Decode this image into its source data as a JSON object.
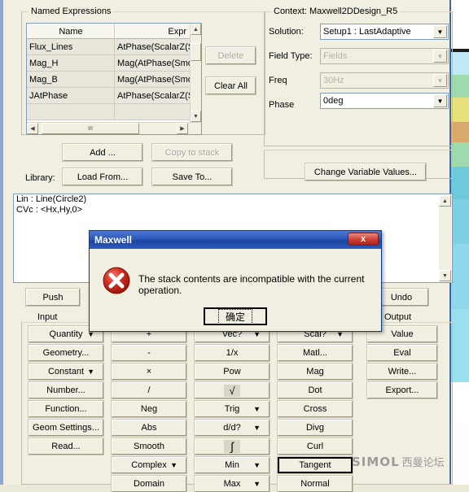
{
  "window": {
    "named_expressions": {
      "legend": "Named Expressions",
      "columns": [
        "Name",
        "Expr"
      ],
      "rows": [
        {
          "name": "Flux_Lines",
          "expr": "AtPhase(ScalarZ(Smo"
        },
        {
          "name": "Mag_H",
          "expr": "Mag(AtPhase(Smooth"
        },
        {
          "name": "Mag_B",
          "expr": "Mag(AtPhase(Smooth"
        },
        {
          "name": "JAtPhase",
          "expr": "AtPhase(ScalarZ(Smo"
        },
        {
          "name": "",
          "expr": ""
        }
      ],
      "delete_label": "Delete",
      "clear_all_label": "Clear All"
    },
    "context": {
      "legend": "Context: Maxwell2DDesign_R5",
      "fields": [
        {
          "label": "Solution:",
          "value": "Setup1 : LastAdaptive",
          "disabled": false
        },
        {
          "label": "Field Type:",
          "value": "Fields",
          "disabled": true
        },
        {
          "label": "Freq",
          "value": "30Hz",
          "disabled": true
        },
        {
          "label": "Phase",
          "value": "0deg",
          "disabled": false
        }
      ],
      "change_variable_values_label": "Change Variable Values..."
    },
    "actions": {
      "add_label": "Add ...",
      "copy_to_stack_label": "Copy to stack",
      "library_label": "Library:",
      "load_from_label": "Load From...",
      "save_to_label": "Save To..."
    },
    "stack": {
      "lines": [
        "Lin : Line(Circle2)",
        "CVc : <Hx,Hy,0>"
      ]
    },
    "stack_controls": {
      "push_label": "Push",
      "undo_label": "Undo",
      "input_label": "Input",
      "output_label": "Output"
    },
    "calculator": {
      "columns": [
        {
          "name": "input",
          "buttons": [
            {
              "label": "Quantity",
              "caret": true
            },
            {
              "label": "Geometry...",
              "caret": false
            },
            {
              "label": "Constant",
              "caret": true
            },
            {
              "label": "Number...",
              "caret": false
            },
            {
              "label": "Function...",
              "caret": false
            },
            {
              "label": "Geom Settings...",
              "caret": false
            },
            {
              "label": "Read...",
              "caret": false
            }
          ]
        },
        {
          "name": "general",
          "buttons": [
            {
              "label": "+",
              "caret": false
            },
            {
              "label": "-",
              "caret": false
            },
            {
              "label": "×",
              "caret": false
            },
            {
              "label": "/",
              "caret": false
            },
            {
              "label": "Neg",
              "caret": false
            },
            {
              "label": "Abs",
              "caret": false
            },
            {
              "label": "Smooth",
              "caret": false
            },
            {
              "label": "Complex",
              "caret": true
            },
            {
              "label": "Domain",
              "caret": false
            }
          ]
        },
        {
          "name": "scalar",
          "buttons": [
            {
              "label": "Vec?",
              "caret": true
            },
            {
              "label": "1/x",
              "caret": false
            },
            {
              "label": "Pow",
              "caret": false
            },
            {
              "label": "√",
              "caret": false
            },
            {
              "label": "Trig",
              "caret": true
            },
            {
              "label": "d/d?",
              "caret": true
            },
            {
              "label": "∫",
              "caret": false
            },
            {
              "label": "Min",
              "caret": true
            },
            {
              "label": "Max",
              "caret": true
            }
          ]
        },
        {
          "name": "vector",
          "buttons": [
            {
              "label": "Scal?",
              "caret": true
            },
            {
              "label": "Matl...",
              "caret": false
            },
            {
              "label": "Mag",
              "caret": false
            },
            {
              "label": "Dot",
              "caret": false
            },
            {
              "label": "Cross",
              "caret": false
            },
            {
              "label": "Divg",
              "caret": false
            },
            {
              "label": "Curl",
              "caret": false
            },
            {
              "label": "Tangent",
              "caret": false,
              "default": true
            },
            {
              "label": "Normal",
              "caret": false
            }
          ]
        },
        {
          "name": "output",
          "buttons": [
            {
              "label": "Value",
              "caret": false
            },
            {
              "label": "Eval",
              "caret": false
            },
            {
              "label": "Write...",
              "caret": false
            },
            {
              "label": "Export...",
              "caret": false
            }
          ]
        }
      ]
    }
  },
  "modal": {
    "title": "Maxwell",
    "close_label": "x",
    "message": "The stack contents are incompatible with the current operation.",
    "ok_label": "确定"
  },
  "watermark": {
    "brand": "SIMOL",
    "cn": "西曼论坛"
  },
  "colors": {
    "titlebar": "#1e459f",
    "error_red": "#c62317",
    "window_bg": "#f1efe2",
    "field_border": "#7f9db9"
  }
}
